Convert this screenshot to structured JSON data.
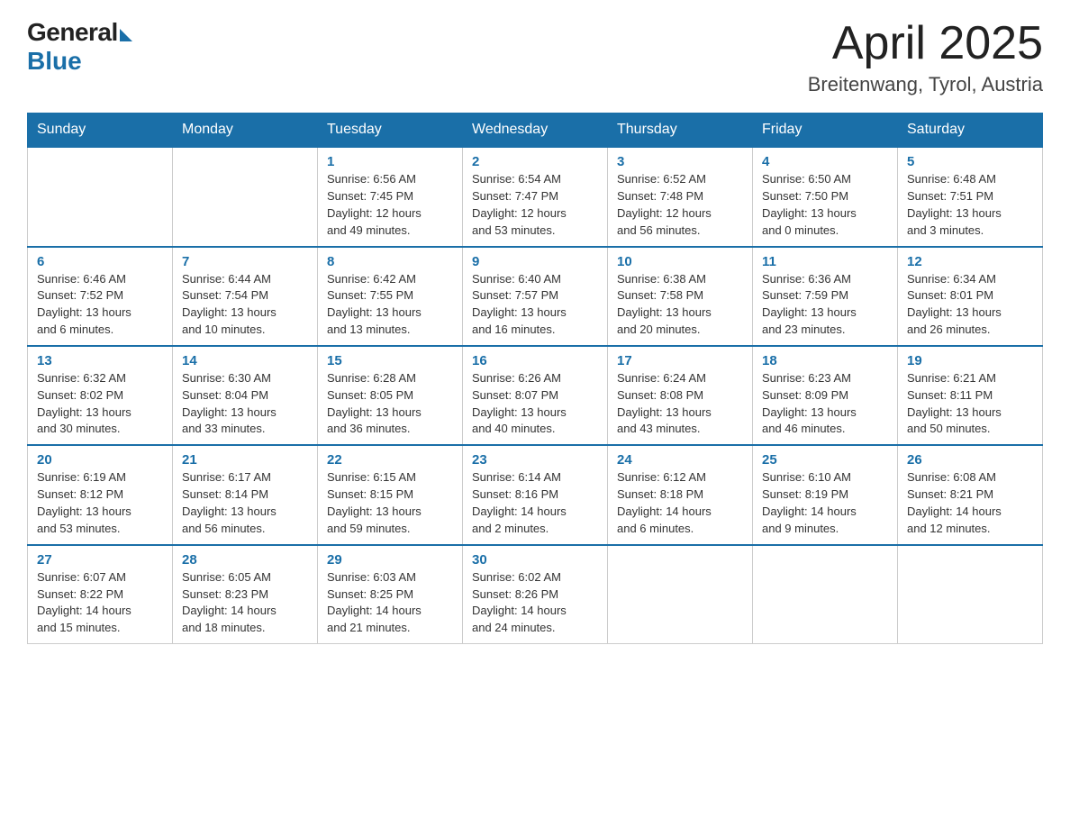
{
  "header": {
    "logo_general": "General",
    "logo_blue": "Blue",
    "title": "April 2025",
    "location": "Breitenwang, Tyrol, Austria"
  },
  "weekdays": [
    "Sunday",
    "Monday",
    "Tuesday",
    "Wednesday",
    "Thursday",
    "Friday",
    "Saturday"
  ],
  "weeks": [
    [
      {
        "day": "",
        "details": ""
      },
      {
        "day": "",
        "details": ""
      },
      {
        "day": "1",
        "details": "Sunrise: 6:56 AM\nSunset: 7:45 PM\nDaylight: 12 hours\nand 49 minutes."
      },
      {
        "day": "2",
        "details": "Sunrise: 6:54 AM\nSunset: 7:47 PM\nDaylight: 12 hours\nand 53 minutes."
      },
      {
        "day": "3",
        "details": "Sunrise: 6:52 AM\nSunset: 7:48 PM\nDaylight: 12 hours\nand 56 minutes."
      },
      {
        "day": "4",
        "details": "Sunrise: 6:50 AM\nSunset: 7:50 PM\nDaylight: 13 hours\nand 0 minutes."
      },
      {
        "day": "5",
        "details": "Sunrise: 6:48 AM\nSunset: 7:51 PM\nDaylight: 13 hours\nand 3 minutes."
      }
    ],
    [
      {
        "day": "6",
        "details": "Sunrise: 6:46 AM\nSunset: 7:52 PM\nDaylight: 13 hours\nand 6 minutes."
      },
      {
        "day": "7",
        "details": "Sunrise: 6:44 AM\nSunset: 7:54 PM\nDaylight: 13 hours\nand 10 minutes."
      },
      {
        "day": "8",
        "details": "Sunrise: 6:42 AM\nSunset: 7:55 PM\nDaylight: 13 hours\nand 13 minutes."
      },
      {
        "day": "9",
        "details": "Sunrise: 6:40 AM\nSunset: 7:57 PM\nDaylight: 13 hours\nand 16 minutes."
      },
      {
        "day": "10",
        "details": "Sunrise: 6:38 AM\nSunset: 7:58 PM\nDaylight: 13 hours\nand 20 minutes."
      },
      {
        "day": "11",
        "details": "Sunrise: 6:36 AM\nSunset: 7:59 PM\nDaylight: 13 hours\nand 23 minutes."
      },
      {
        "day": "12",
        "details": "Sunrise: 6:34 AM\nSunset: 8:01 PM\nDaylight: 13 hours\nand 26 minutes."
      }
    ],
    [
      {
        "day": "13",
        "details": "Sunrise: 6:32 AM\nSunset: 8:02 PM\nDaylight: 13 hours\nand 30 minutes."
      },
      {
        "day": "14",
        "details": "Sunrise: 6:30 AM\nSunset: 8:04 PM\nDaylight: 13 hours\nand 33 minutes."
      },
      {
        "day": "15",
        "details": "Sunrise: 6:28 AM\nSunset: 8:05 PM\nDaylight: 13 hours\nand 36 minutes."
      },
      {
        "day": "16",
        "details": "Sunrise: 6:26 AM\nSunset: 8:07 PM\nDaylight: 13 hours\nand 40 minutes."
      },
      {
        "day": "17",
        "details": "Sunrise: 6:24 AM\nSunset: 8:08 PM\nDaylight: 13 hours\nand 43 minutes."
      },
      {
        "day": "18",
        "details": "Sunrise: 6:23 AM\nSunset: 8:09 PM\nDaylight: 13 hours\nand 46 minutes."
      },
      {
        "day": "19",
        "details": "Sunrise: 6:21 AM\nSunset: 8:11 PM\nDaylight: 13 hours\nand 50 minutes."
      }
    ],
    [
      {
        "day": "20",
        "details": "Sunrise: 6:19 AM\nSunset: 8:12 PM\nDaylight: 13 hours\nand 53 minutes."
      },
      {
        "day": "21",
        "details": "Sunrise: 6:17 AM\nSunset: 8:14 PM\nDaylight: 13 hours\nand 56 minutes."
      },
      {
        "day": "22",
        "details": "Sunrise: 6:15 AM\nSunset: 8:15 PM\nDaylight: 13 hours\nand 59 minutes."
      },
      {
        "day": "23",
        "details": "Sunrise: 6:14 AM\nSunset: 8:16 PM\nDaylight: 14 hours\nand 2 minutes."
      },
      {
        "day": "24",
        "details": "Sunrise: 6:12 AM\nSunset: 8:18 PM\nDaylight: 14 hours\nand 6 minutes."
      },
      {
        "day": "25",
        "details": "Sunrise: 6:10 AM\nSunset: 8:19 PM\nDaylight: 14 hours\nand 9 minutes."
      },
      {
        "day": "26",
        "details": "Sunrise: 6:08 AM\nSunset: 8:21 PM\nDaylight: 14 hours\nand 12 minutes."
      }
    ],
    [
      {
        "day": "27",
        "details": "Sunrise: 6:07 AM\nSunset: 8:22 PM\nDaylight: 14 hours\nand 15 minutes."
      },
      {
        "day": "28",
        "details": "Sunrise: 6:05 AM\nSunset: 8:23 PM\nDaylight: 14 hours\nand 18 minutes."
      },
      {
        "day": "29",
        "details": "Sunrise: 6:03 AM\nSunset: 8:25 PM\nDaylight: 14 hours\nand 21 minutes."
      },
      {
        "day": "30",
        "details": "Sunrise: 6:02 AM\nSunset: 8:26 PM\nDaylight: 14 hours\nand 24 minutes."
      },
      {
        "day": "",
        "details": ""
      },
      {
        "day": "",
        "details": ""
      },
      {
        "day": "",
        "details": ""
      }
    ]
  ]
}
